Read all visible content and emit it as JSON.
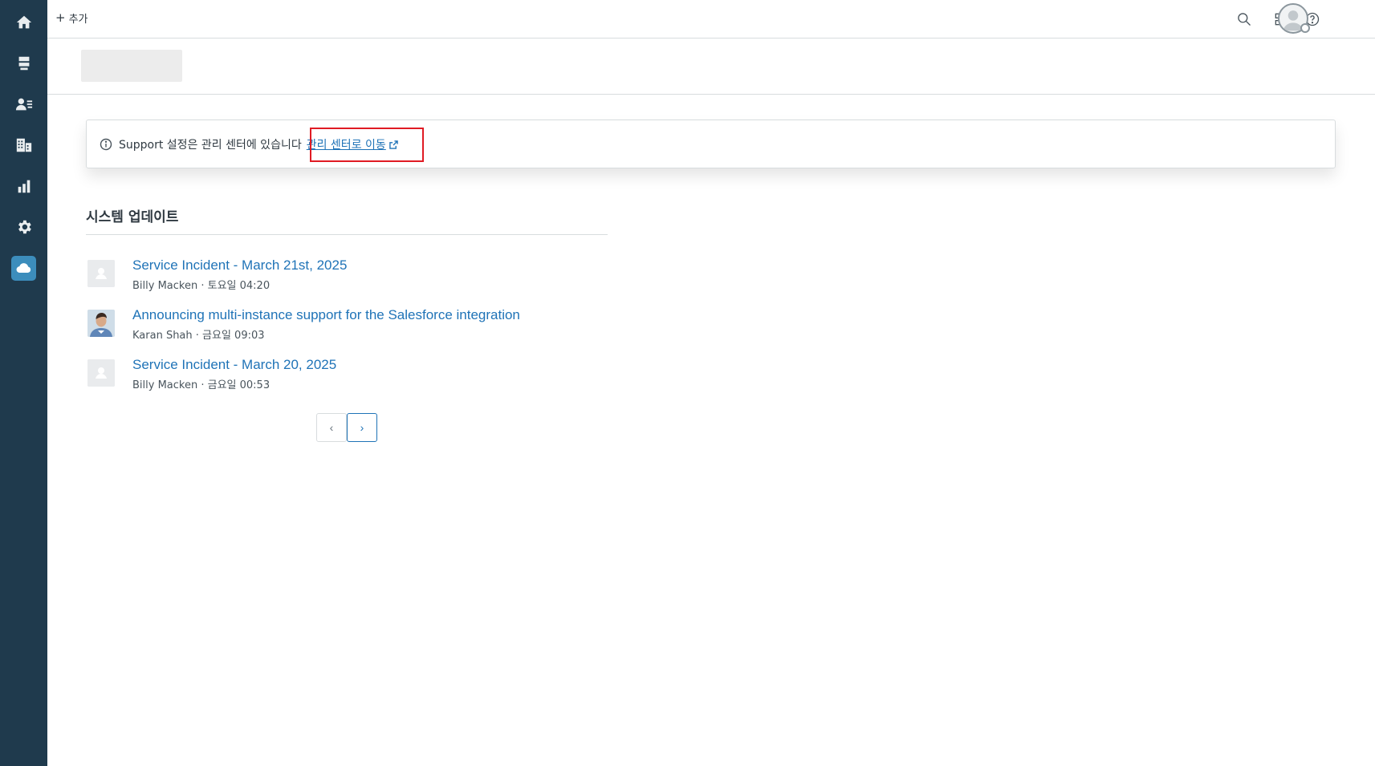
{
  "sidebar": {
    "items": [
      {
        "name": "home-icon"
      },
      {
        "name": "views-icon"
      },
      {
        "name": "customers-icon"
      },
      {
        "name": "organizations-icon"
      },
      {
        "name": "reporting-icon"
      },
      {
        "name": "admin-gear-icon"
      },
      {
        "name": "cloud-app-icon",
        "active": true
      }
    ]
  },
  "topbar": {
    "add_label": "추가",
    "add_icon": "plus-icon",
    "icons": [
      "search-icon",
      "apps-grid-icon",
      "help-icon",
      "user-avatar-icon"
    ]
  },
  "notice": {
    "text": "Support 설정은 관리 센터에 있습니다",
    "link_label": "관리 센터로 이동",
    "link_icon": "external-link-icon"
  },
  "updates": {
    "title": "시스템 업데이트",
    "items": [
      {
        "title": "Service Incident - March 21st, 2025",
        "author": "Billy Macken",
        "time": "토요일 04:20",
        "meta": "Billy Macken · 토요일 04:20",
        "avatar": "default-avatar"
      },
      {
        "title": "Announcing multi-instance support for the Salesforce integration",
        "author": "Karan Shah",
        "time": "금요일 09:03",
        "meta": "Karan Shah · 금요일 09:03",
        "avatar": "photo-avatar"
      },
      {
        "title": "Service Incident - March 20, 2025",
        "author": "Billy Macken",
        "time": "금요일 00:53",
        "meta": "Billy Macken · 금요일 00:53",
        "avatar": "default-avatar"
      }
    ]
  },
  "pagination": {
    "prev": "‹",
    "next": "›"
  },
  "colors": {
    "sidebar_bg": "#1f3a4d",
    "link": "#1f73b7",
    "active_item": "#3c8dbc",
    "highlight": "#e01b24"
  }
}
